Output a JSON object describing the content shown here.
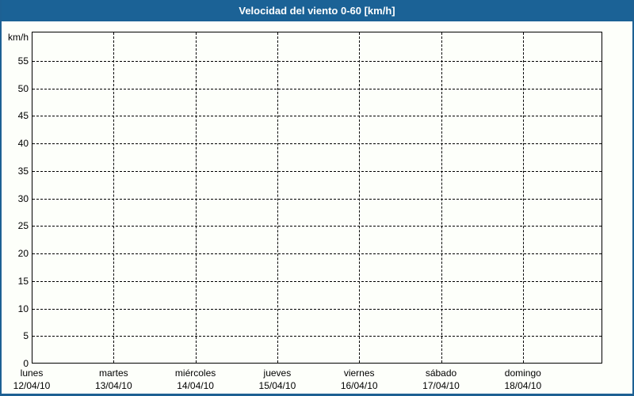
{
  "window": {
    "title": "Velocidad del viento 0-60 [km/h]"
  },
  "colors": {
    "titlebar_bg": "#1b6296",
    "titlebar_text": "#ffffff",
    "page_border": "#1d6093",
    "page_bg": "#fdfffa",
    "plot_border": "#000000",
    "gridline": "#000000",
    "label_text": "#000000"
  },
  "chart_data": {
    "type": "line",
    "title": "Velocidad del viento 0-60 [km/h]",
    "xlabel": "",
    "ylabel": "km/h",
    "ylim": [
      0,
      60.3
    ],
    "yticks": [
      0,
      5,
      10,
      15,
      20,
      25,
      30,
      35,
      40,
      45,
      50,
      55
    ],
    "grid": "dashed",
    "legend": "none",
    "x_categories": [
      {
        "day": "lunes",
        "date": "12/04/10"
      },
      {
        "day": "martes",
        "date": "13/04/10"
      },
      {
        "day": "miércoles",
        "date": "14/04/10"
      },
      {
        "day": "jueves",
        "date": "15/04/10"
      },
      {
        "day": "viernes",
        "date": "16/04/10"
      },
      {
        "day": "sábado",
        "date": "17/04/10"
      },
      {
        "day": "domingo",
        "date": "18/04/10"
      }
    ],
    "series": []
  }
}
